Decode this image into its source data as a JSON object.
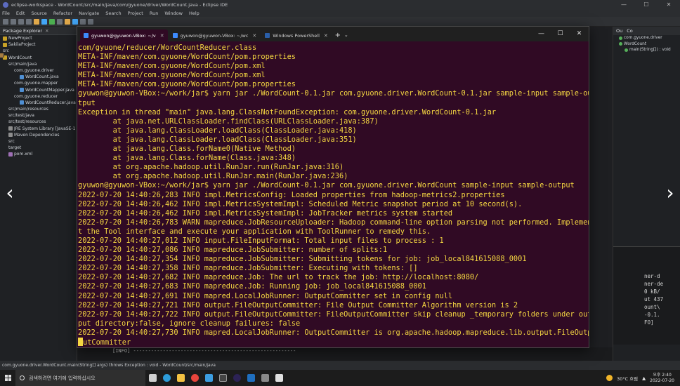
{
  "eclipse": {
    "title": "eclipse-workspace - WordCount/src/main/java/com/gyuone/driver/WordCount.java - Eclipse IDE",
    "menu": [
      "File",
      "Edit",
      "Source",
      "Refactor",
      "Navigate",
      "Search",
      "Project",
      "Run",
      "Window",
      "Help"
    ],
    "package_explorer": {
      "tab_label": "Package Explorer",
      "items": [
        "NewProject",
        "SakilaProject",
        "src",
        "WordCount",
        "src/main/java",
        "com.gyuone.driver",
        "WordCount.java",
        "com.gyuone.mapper",
        "WordCountMapper.java",
        "com.gyuone.reducer",
        "WordCountReducer.java",
        "src/main/resources",
        "src/test/java",
        "src/test/resources",
        "JRE System Library [JavaSE-1",
        "Maven Dependencies",
        "src",
        "target",
        "pom.xml"
      ]
    },
    "outline": {
      "tabs": [
        "Ou",
        "Co"
      ],
      "items": [
        "com.gyuone.driver",
        "WordCount",
        "main(String[]) : void"
      ]
    },
    "console_fragments": [
      "ner-d",
      "ner-de",
      "0 kB/",
      "ut 437",
      "ount\\",
      "-0.1.",
      "FO]"
    ],
    "under_console_text": "[INFO] -------------------------------------------------------",
    "status_bar": "com.gyuone.driver.WordCount.main(String[] args) throws Exception : void - WordCount/src/main/java"
  },
  "terminal": {
    "tabs": [
      {
        "label": "gyuwon@gyuwon-VBox: ~/v",
        "active": true
      },
      {
        "label": "gyuwon@gyuwon-VBox: ~/wc",
        "active": false
      },
      {
        "label": "Windows PowerShell",
        "active": false
      }
    ],
    "lines": [
      "com/gyuone/reducer/WordCountReducer.class",
      "META-INF/maven/com.gyuone/WordCount/pom.properties",
      "META-INF/maven/com.gyuone/WordCount/pom.xml",
      "META-INF/maven/com.gyuone/WordCount/pom.xml",
      "META-INF/maven/com.gyuone/WordCount/pom.properties",
      "gyuwon@gyuwon-VBox:~/work/jar$ yarn jar ./WordCount-0.1.jar com.gyuone.driver.WordCount-0.1.jar sample-input sample-ou",
      "tput",
      "Exception in thread \"main\" java.lang.ClassNotFoundException: com.gyuone.driver.WordCount-0.1.jar",
      "        at java.net.URLClassLoader.findClass(URLClassLoader.java:387)",
      "        at java.lang.ClassLoader.loadClass(ClassLoader.java:418)",
      "        at java.lang.ClassLoader.loadClass(ClassLoader.java:351)",
      "        at java.lang.Class.forName0(Native Method)",
      "        at java.lang.Class.forName(Class.java:348)",
      "        at org.apache.hadoop.util.RunJar.run(RunJar.java:316)",
      "        at org.apache.hadoop.util.RunJar.main(RunJar.java:236)",
      "gyuwon@gyuwon-VBox:~/work/jar$ yarn jar ./WordCount-0.1.jar com.gyuone.driver.WordCount sample-input sample-output",
      "2022-07-20 14:40:26,283 INFO impl.MetricsConfig: Loaded properties from hadoop-metrics2.properties",
      "2022-07-20 14:40:26,462 INFO impl.MetricsSystemImpl: Scheduled Metric snapshot period at 10 second(s).",
      "2022-07-20 14:40:26,462 INFO impl.MetricsSystemImpl: JobTracker metrics system started",
      "2022-07-20 14:40:26,783 WARN mapreduce.JobResourceUploader: Hadoop command-line option parsing not performed. Implemen",
      "t the Tool interface and execute your application with ToolRunner to remedy this.",
      "2022-07-20 14:40:27,012 INFO input.FileInputFormat: Total input files to process : 1",
      "2022-07-20 14:40:27,086 INFO mapreduce.JobSubmitter: number of splits:1",
      "2022-07-20 14:40:27,354 INFO mapreduce.JobSubmitter: Submitting tokens for job: job_local841615088_0001",
      "2022-07-20 14:40:27,358 INFO mapreduce.JobSubmitter: Executing with tokens: []",
      "2022-07-20 14:40:27,682 INFO mapreduce.Job: The url to track the job: http://localhost:8080/",
      "2022-07-20 14:40:27,683 INFO mapreduce.Job: Running job: job_local841615088_0001",
      "2022-07-20 14:40:27,691 INFO mapred.LocalJobRunner: OutputCommitter set in config null",
      "2022-07-20 14:40:27,721 INFO output.FileOutputCommitter: File Output Committer Algorithm version is 2",
      "2022-07-20 14:40:27,722 INFO output.FileOutputCommitter: FileOutputCommitter skip cleanup _temporary folders under out",
      "put directory:false, ignore cleanup failures: false",
      "2022-07-20 14:40:27,730 INFO mapred.LocalJobRunner: OutputCommitter is org.apache.hadoop.mapreduce.lib.output.FileOutp",
      "utCommitter"
    ],
    "text_color": "#f5d742",
    "background": "#300a24"
  },
  "taskbar": {
    "search_placeholder": "검색하려면 여기에 입력하십시오",
    "weather": "30°C 흐림",
    "time": "오후 2:40",
    "date": "2022-07-20"
  },
  "icons": {
    "nav_left": "‹",
    "nav_right": "›",
    "new_tab": "+",
    "tab_dropdown": "⌄",
    "minimize": "—",
    "maximize": "☐",
    "close": "✕"
  }
}
